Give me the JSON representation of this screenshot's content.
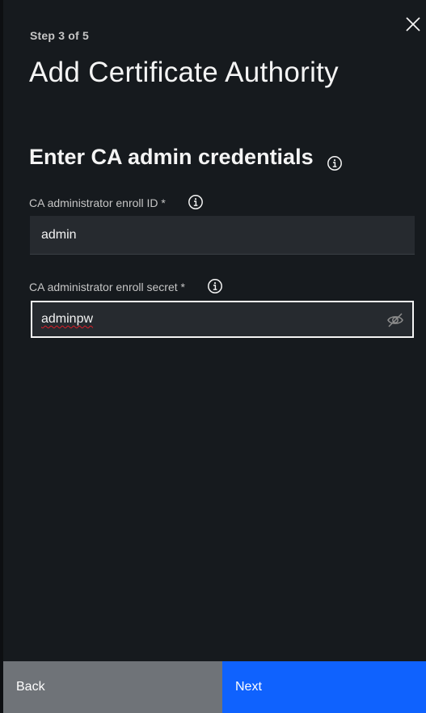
{
  "step": "Step 3 of 5",
  "title": "Add Certificate Authority",
  "section_title": "Enter CA admin credentials",
  "fields": {
    "enroll_id": {
      "label": "CA administrator enroll ID *",
      "value": "admin"
    },
    "enroll_secret": {
      "label": "CA administrator enroll secret *",
      "value": "adminpw"
    }
  },
  "footer": {
    "back_label": "Back",
    "next_label": "Next"
  },
  "colors": {
    "background": "#161a1e",
    "input_bg": "#262a2f",
    "primary": "#0f62fe",
    "secondary": "#6f7378"
  },
  "icons": [
    "close-icon",
    "info-icon",
    "view-off-icon"
  ]
}
